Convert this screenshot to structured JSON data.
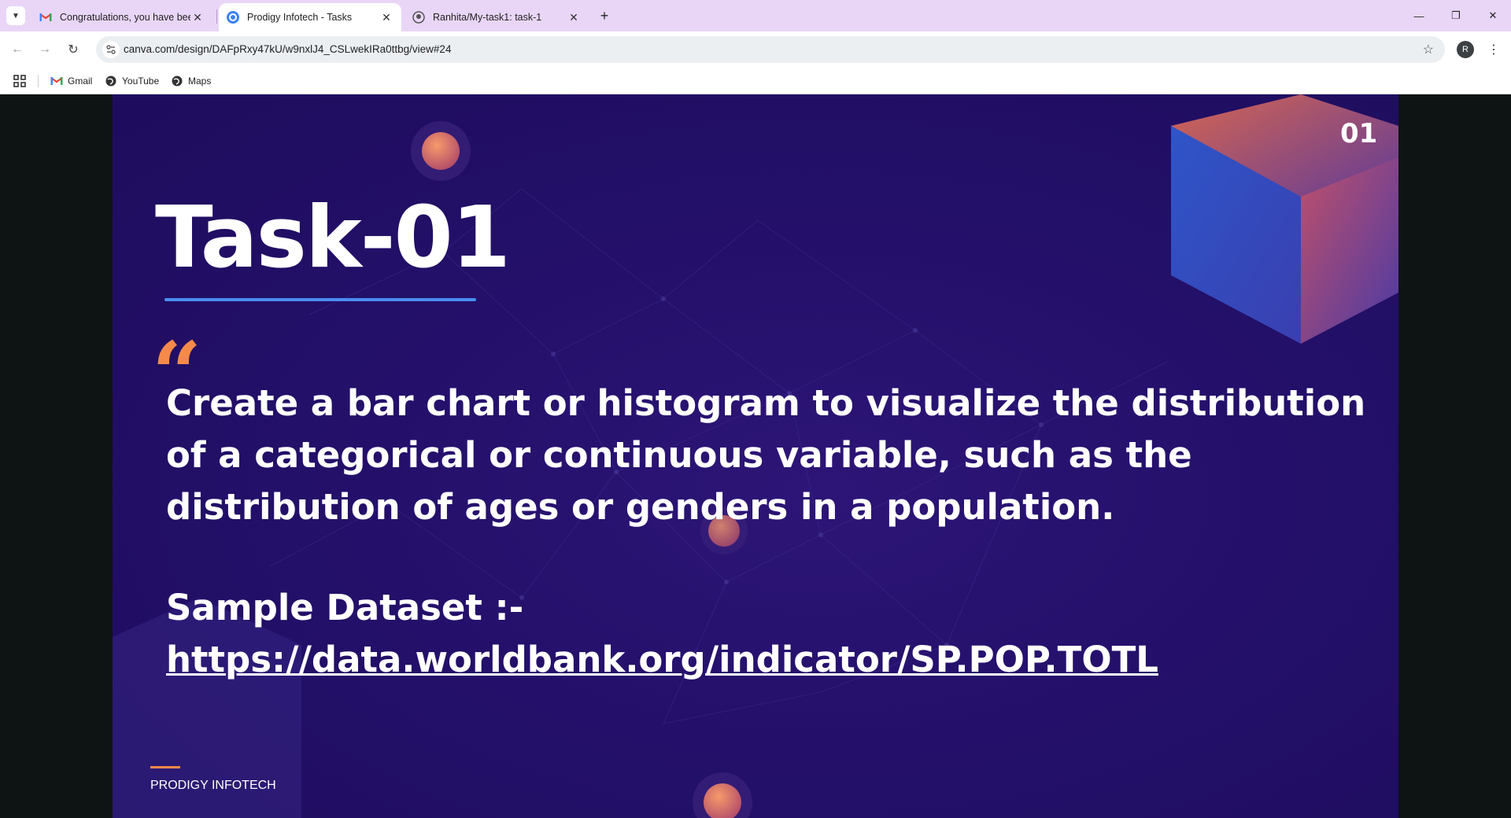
{
  "browser": {
    "tabs": [
      {
        "title": "Congratulations, you have been",
        "favicon": "gmail-icon",
        "active": false
      },
      {
        "title": "Prodigy Infotech - Tasks",
        "favicon": "canva-icon",
        "active": true
      },
      {
        "title": "Ranhita/My-task1: task-1",
        "favicon": "github-icon",
        "active": false
      }
    ],
    "address": "canva.com/design/DAFpRxy47kU/w9nxlJ4_CSLwekIRa0ttbg/view#24",
    "profile_initial": "R",
    "bookmarks": [
      {
        "label": "Gmail",
        "icon": "gmail-icon"
      },
      {
        "label": "YouTube",
        "icon": "globe-icon"
      },
      {
        "label": "Maps",
        "icon": "globe-icon"
      }
    ]
  },
  "slide": {
    "number": "01",
    "title": "Task-01",
    "quote_mark": "“",
    "body": "Create a bar chart or histogram to visualize the distribution of a categorical or continuous variable, such as the distribution of ages or genders in a population.",
    "sample_label": "Sample Dataset :-",
    "sample_link": "https://data.worldbank.org/indicator/SP.POP.TOTL",
    "footer": "PRODIGY INFOTECH"
  },
  "colors": {
    "tabstrip": "#e9d6f7",
    "slide_bg": "#24106a",
    "accent_orange": "#f58a4a",
    "accent_blue": "#4a8df0"
  }
}
